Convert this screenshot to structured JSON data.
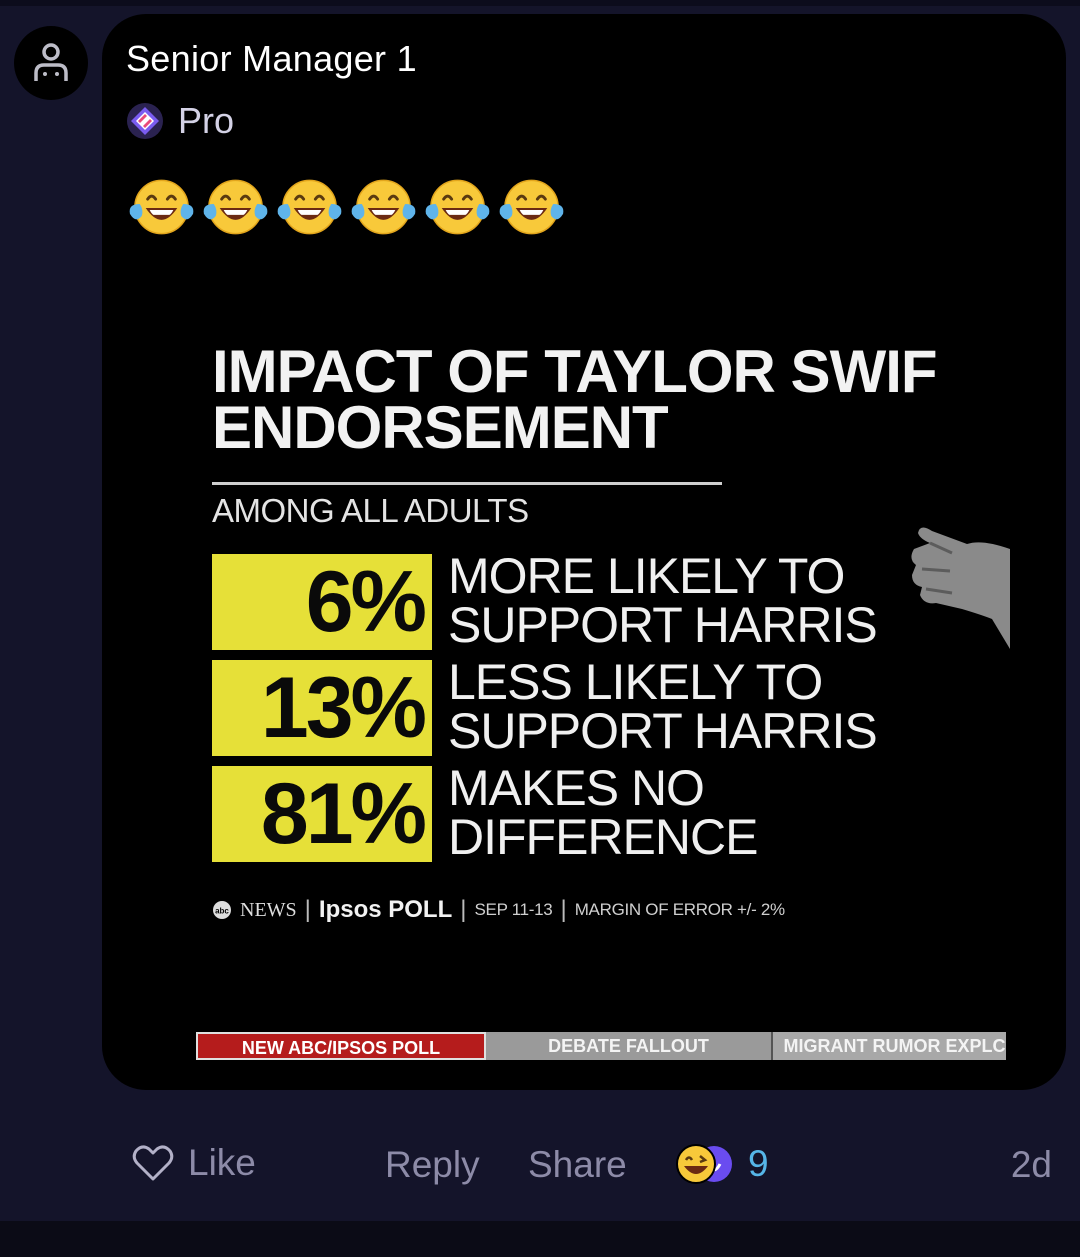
{
  "comment": {
    "author": "Senior Manager 1",
    "badge": "Pro",
    "text_emojis": [
      "😂",
      "😂",
      "😂",
      "😂",
      "😂",
      "😂"
    ],
    "avatar_icon": "user-outline-icon",
    "badge_icon": "pro-diamond-icon"
  },
  "graphic": {
    "title_line1": "IMPACT OF TAYLOR SWIF",
    "title_line2": "ENDORSEMENT",
    "subtitle": "AMONG ALL ADULTS",
    "rows": [
      {
        "value": "6%",
        "label_line1": "MORE LIKELY TO",
        "label_line2": "SUPPORT HARRIS"
      },
      {
        "value": "13%",
        "label_line1": "LESS LIKELY TO",
        "label_line2": "SUPPORT HARRIS"
      },
      {
        "value": "81%",
        "label_line1": "MAKES NO",
        "label_line2": "DIFFERENCE"
      }
    ],
    "source": {
      "network": "NEWS",
      "pollster": "Ipsos POLL",
      "dates": "SEP 11-13",
      "margin": "MARGIN OF ERROR +/- 2%"
    },
    "ticker": [
      "NEW ABC/IPSOS POLL",
      "DEBATE FALLOUT",
      "MIGRANT RUMOR EXPLC"
    ]
  },
  "actions": {
    "like": "Like",
    "reply": "Reply",
    "share": "Share",
    "reaction_count": "9",
    "timestamp": "2d"
  },
  "colors": {
    "background": "#14142a",
    "card": "#000000",
    "highlight_yellow": "#e6e038",
    "reaction_blue": "#56b6e8",
    "muted_text": "#8d8ba8"
  }
}
